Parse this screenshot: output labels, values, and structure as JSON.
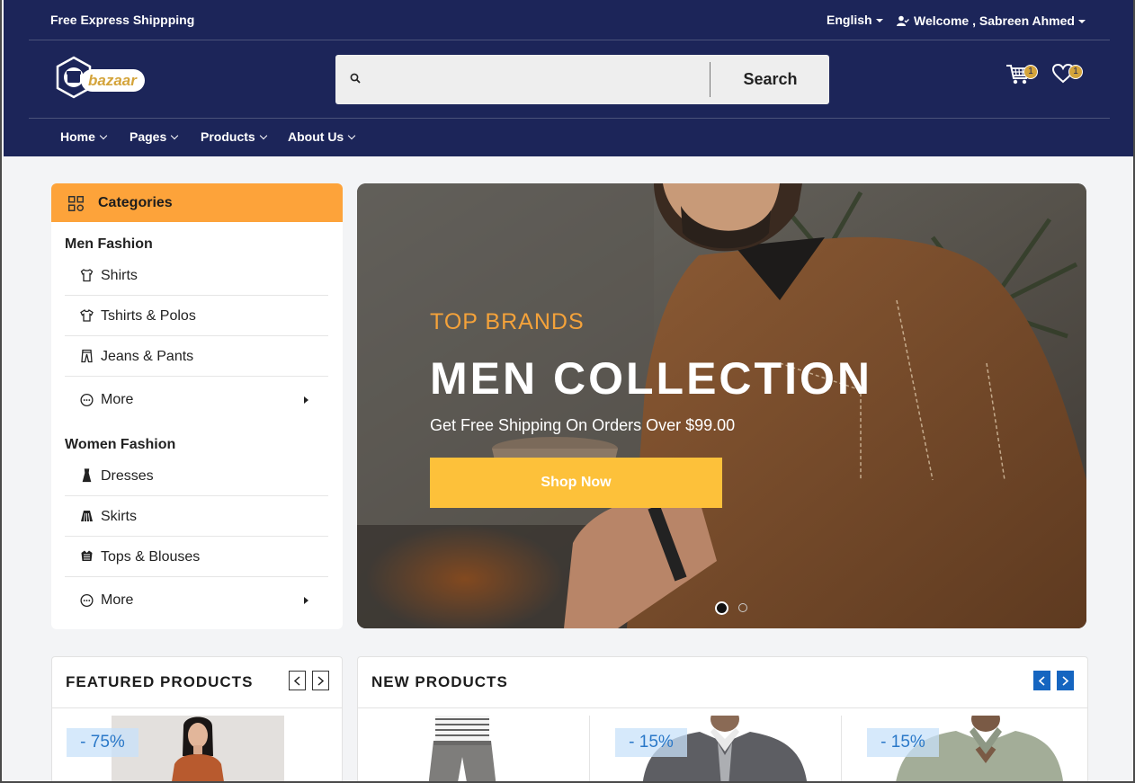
{
  "topbar": {
    "shipping_text": "Free Express Shippping",
    "language": "English",
    "welcome": "Welcome , Sabreen Ahmed"
  },
  "logo": {
    "text": "bazaar"
  },
  "search": {
    "placeholder": "",
    "button_label": "Search"
  },
  "cart": {
    "count": "1"
  },
  "wishlist": {
    "count": "1"
  },
  "nav": {
    "items": [
      {
        "label": "Home"
      },
      {
        "label": "Pages"
      },
      {
        "label": "Products"
      },
      {
        "label": "About Us"
      }
    ]
  },
  "categories": {
    "title": "Categories",
    "groups": [
      {
        "title": "Men Fashion",
        "items": [
          "Shirts",
          "Tshirts & Polos",
          "Jeans & Pants",
          "More"
        ]
      },
      {
        "title": "Women Fashion",
        "items": [
          "Dresses",
          "Skirts",
          "Tops & Blouses",
          "More"
        ]
      }
    ]
  },
  "hero": {
    "kicker": "TOP BRANDS",
    "title": "MEN COLLECTION",
    "subtitle": "Get Free Shipping On Orders Over $99.00",
    "cta": "Shop Now",
    "slides": 2,
    "active_slide": 1
  },
  "featured": {
    "title": "FEATURED PRODUCTS",
    "discount": "- 75%"
  },
  "new_products": {
    "title": "NEW PRODUCTS",
    "discounts": [
      "- 15%",
      "- 15%"
    ]
  },
  "colors": {
    "navy": "#1c2559",
    "orange": "#fda33a",
    "yellow": "#fdc13a",
    "accent_blue": "#1565c0",
    "gold": "#d4a43b"
  }
}
